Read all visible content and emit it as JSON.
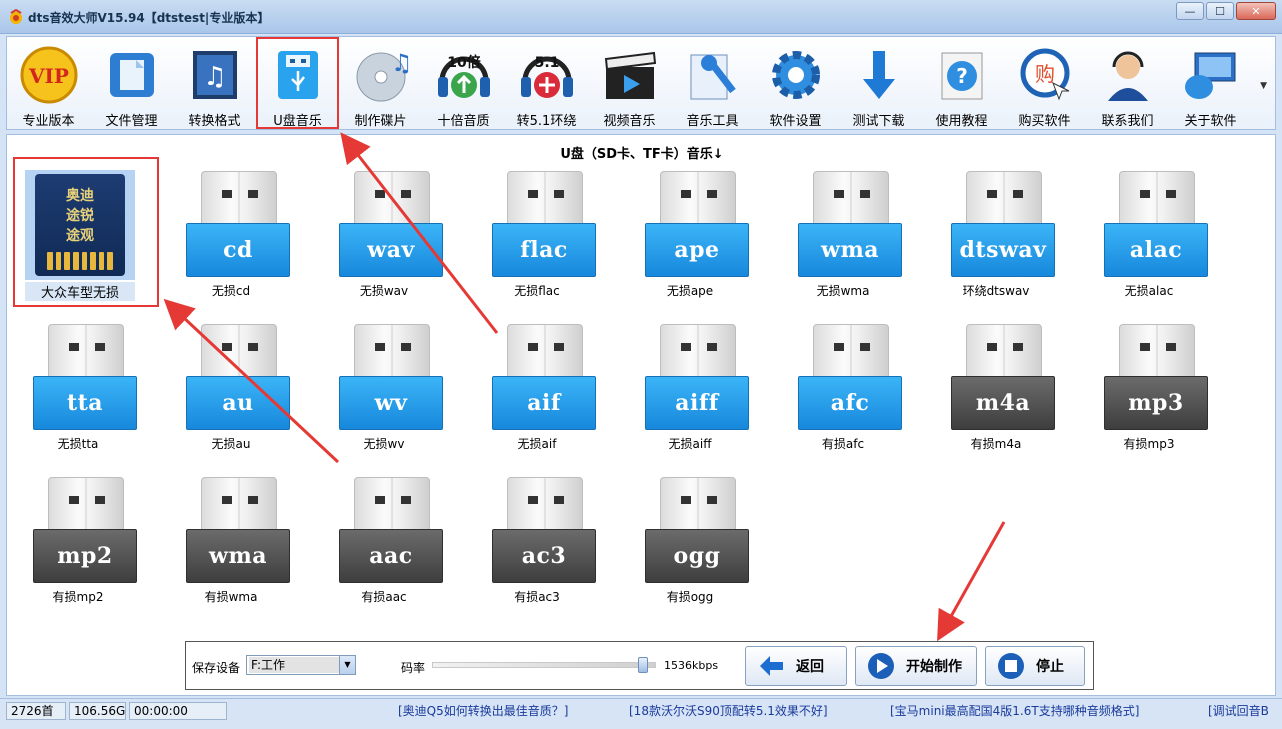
{
  "window": {
    "title": "dts音效大师V15.94【dtstest|专业版本】",
    "buttons": [
      "—",
      "☐",
      "✕"
    ]
  },
  "toolbar": {
    "items": [
      {
        "label": "专业版本",
        "icon": "vip-icon"
      },
      {
        "label": "文件管理",
        "icon": "file-icon"
      },
      {
        "label": "转换格式",
        "icon": "music-convert-icon"
      },
      {
        "label": "U盘音乐",
        "icon": "usb-icon"
      },
      {
        "label": "制作碟片",
        "icon": "disc-icon"
      },
      {
        "label": "十倍音质",
        "icon": "headphone-10x-icon"
      },
      {
        "label": "转5.1环绕",
        "icon": "headphone-51-icon"
      },
      {
        "label": "视频音乐",
        "icon": "clapper-icon"
      },
      {
        "label": "音乐工具",
        "icon": "tools-icon"
      },
      {
        "label": "软件设置",
        "icon": "gear-icon"
      },
      {
        "label": "测试下载",
        "icon": "download-icon"
      },
      {
        "label": "使用教程",
        "icon": "help-icon"
      },
      {
        "label": "购买软件",
        "icon": "buy-icon"
      },
      {
        "label": "联系我们",
        "icon": "support-icon"
      },
      {
        "label": "关于软件",
        "icon": "computer-icon"
      }
    ],
    "overflow": "▼",
    "vip_text": "VIP",
    "ten_text": "10倍",
    "fiveone_text": "5.1",
    "buy_text": "购"
  },
  "main": {
    "section_title": "U盘（SD卡、TF卡）音乐↓",
    "featured": {
      "card_text": "奥迪\n途锐\n途观",
      "label": "大众车型无损"
    },
    "formats": [
      {
        "format": "cd",
        "caption": "无损cd",
        "style": "blue"
      },
      {
        "format": "wav",
        "caption": "无损wav",
        "style": "blue"
      },
      {
        "format": "flac",
        "caption": "无损flac",
        "style": "blue"
      },
      {
        "format": "ape",
        "caption": "无损ape",
        "style": "blue"
      },
      {
        "format": "wma",
        "caption": "无损wma",
        "style": "blue"
      },
      {
        "format": "dtswav",
        "caption": "环绕dtswav",
        "style": "blue"
      },
      {
        "format": "alac",
        "caption": "无损alac",
        "style": "blue"
      },
      {
        "format": "tta",
        "caption": "无损tta",
        "style": "blue"
      },
      {
        "format": "au",
        "caption": "无损au",
        "style": "blue"
      },
      {
        "format": "wv",
        "caption": "无损wv",
        "style": "blue"
      },
      {
        "format": "aif",
        "caption": "无损aif",
        "style": "blue"
      },
      {
        "format": "aiff",
        "caption": "无损aiff",
        "style": "blue"
      },
      {
        "format": "afc",
        "caption": "有损afc",
        "style": "blue"
      },
      {
        "format": "m4a",
        "caption": "有损m4a",
        "style": "gray"
      },
      {
        "format": "mp3",
        "caption": "有损mp3",
        "style": "gray"
      },
      {
        "format": "mp2",
        "caption": "有损mp2",
        "style": "gray"
      },
      {
        "format": "wma",
        "caption": "有损wma",
        "style": "gray"
      },
      {
        "format": "aac",
        "caption": "有损aac",
        "style": "gray"
      },
      {
        "format": "ac3",
        "caption": "有损ac3",
        "style": "gray"
      },
      {
        "format": "ogg",
        "caption": "有损ogg",
        "style": "gray"
      }
    ]
  },
  "controls": {
    "save_device_label": "保存设备",
    "save_device_value": "F:工作",
    "bitrate_label": "码率",
    "bitrate_value": "1536kbps",
    "bitrate_fraction": 0.96,
    "back_label": "返回",
    "start_label": "开始制作",
    "stop_label": "停止"
  },
  "status": {
    "count": "2726首",
    "size": "106.56G",
    "time": "00:00:00",
    "links": [
      "[奥迪Q5如何转换出最佳音质？]",
      "[18款沃尔沃S90顶配转5.1效果不好]",
      "[宝马mini最高配国4版1.6T支持哪种音频格式]",
      "[调试回音B"
    ]
  },
  "colors": {
    "accent_red": "#e53935",
    "usb_blue": "#1788dc",
    "usb_gray": "#3e3e3e"
  }
}
